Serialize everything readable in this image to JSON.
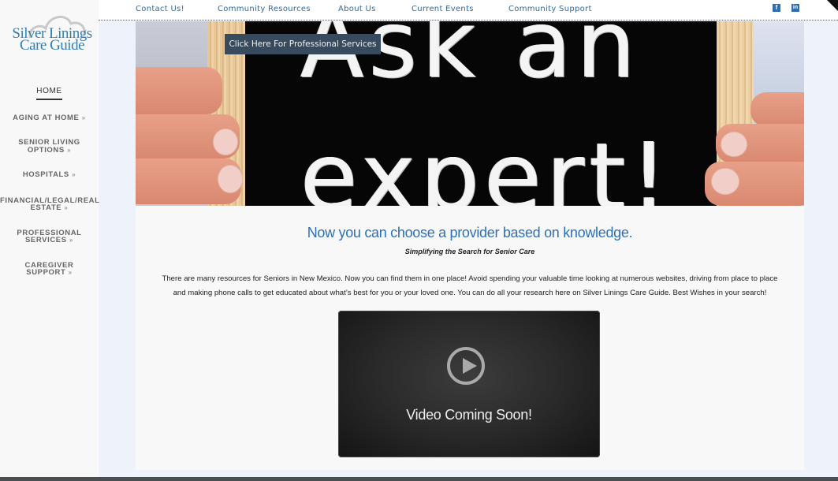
{
  "brand": {
    "logo_line1": "Silver Linings",
    "logo_line2": "Care Guide"
  },
  "sidebar": {
    "items": [
      {
        "label": "HOME",
        "active": true,
        "has_submenu": false
      },
      {
        "label": "AGING AT HOME",
        "has_submenu": true
      },
      {
        "label": "SENIOR LIVING",
        "label2": "OPTIONS",
        "has_submenu": true
      },
      {
        "label": "HOSPITALS",
        "has_submenu": true
      },
      {
        "label": "FINANCIAL/LEGAL/REAL",
        "label2": "ESTATE",
        "has_submenu": true
      },
      {
        "label": "PROFESSIONAL",
        "label2": "SERVICES",
        "has_submenu": true
      },
      {
        "label": "CAREGIVER",
        "label2": "SUPPORT",
        "has_submenu": true
      }
    ],
    "chevron_glyph": "»"
  },
  "topnav": {
    "links": [
      "Contact Us!",
      "Community Resources",
      "About Us",
      "Current Events",
      "Community Support"
    ],
    "social": [
      {
        "name": "facebook",
        "glyph": "f"
      },
      {
        "name": "linkedin",
        "glyph": "in"
      }
    ]
  },
  "hero": {
    "chalk_line1": "Ask an",
    "chalk_line2": "expert!",
    "cta_label": "Click Here For Professional Services"
  },
  "content": {
    "headline": "Now you can choose a provider based on knowledge.",
    "tagline": "Simplifying the Search for Senior Care",
    "paragraph_line1": "There are many resources for Seniors in New Mexico.  Now you can find them in one place! Avoid spending your valuable time looking at numerous websites, driving from place to place",
    "paragraph_line2": "and making phone calls to get educated about what’s best for you or  your loved one.  You can do all your research here on Silver Linings Care Guide.  Best Wishes in your search!"
  },
  "video": {
    "label": "Video Coming Soon!"
  },
  "colors": {
    "brand_blue": "#2d70b6",
    "link_blue": "#2d6aa3",
    "cta_bg": "#374a5e",
    "page_bg": "#eef3fb",
    "panel_bg": "#f8f8f8"
  }
}
